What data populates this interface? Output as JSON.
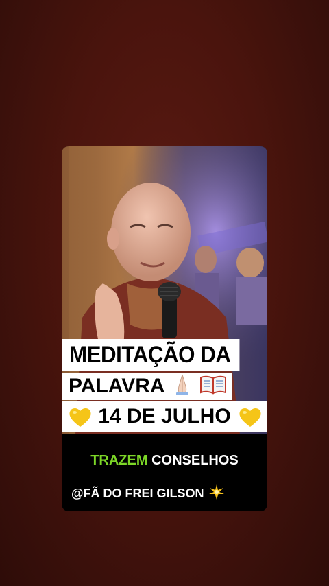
{
  "caption": {
    "line1": "MEDITAÇÃO DA",
    "line2": "PALAVRA",
    "line2_emojis": [
      "praying-hands-icon",
      "open-book-icon"
    ],
    "line3": "14 DE JULHO",
    "line3_emojis": [
      "yellow-heart-icon",
      "yellow-heart-icon"
    ]
  },
  "subtitle": {
    "accent_word": "TRAZEM",
    "rest": "CONSELHOS",
    "accent_color": "#7cd627"
  },
  "handle": {
    "text": "@FÃ DO FREI GILSON",
    "icon": "sparkle-star-icon"
  },
  "colors": {
    "background": "#4a140d",
    "caption_bg": "#ffffff",
    "heart": "#f5c518"
  }
}
